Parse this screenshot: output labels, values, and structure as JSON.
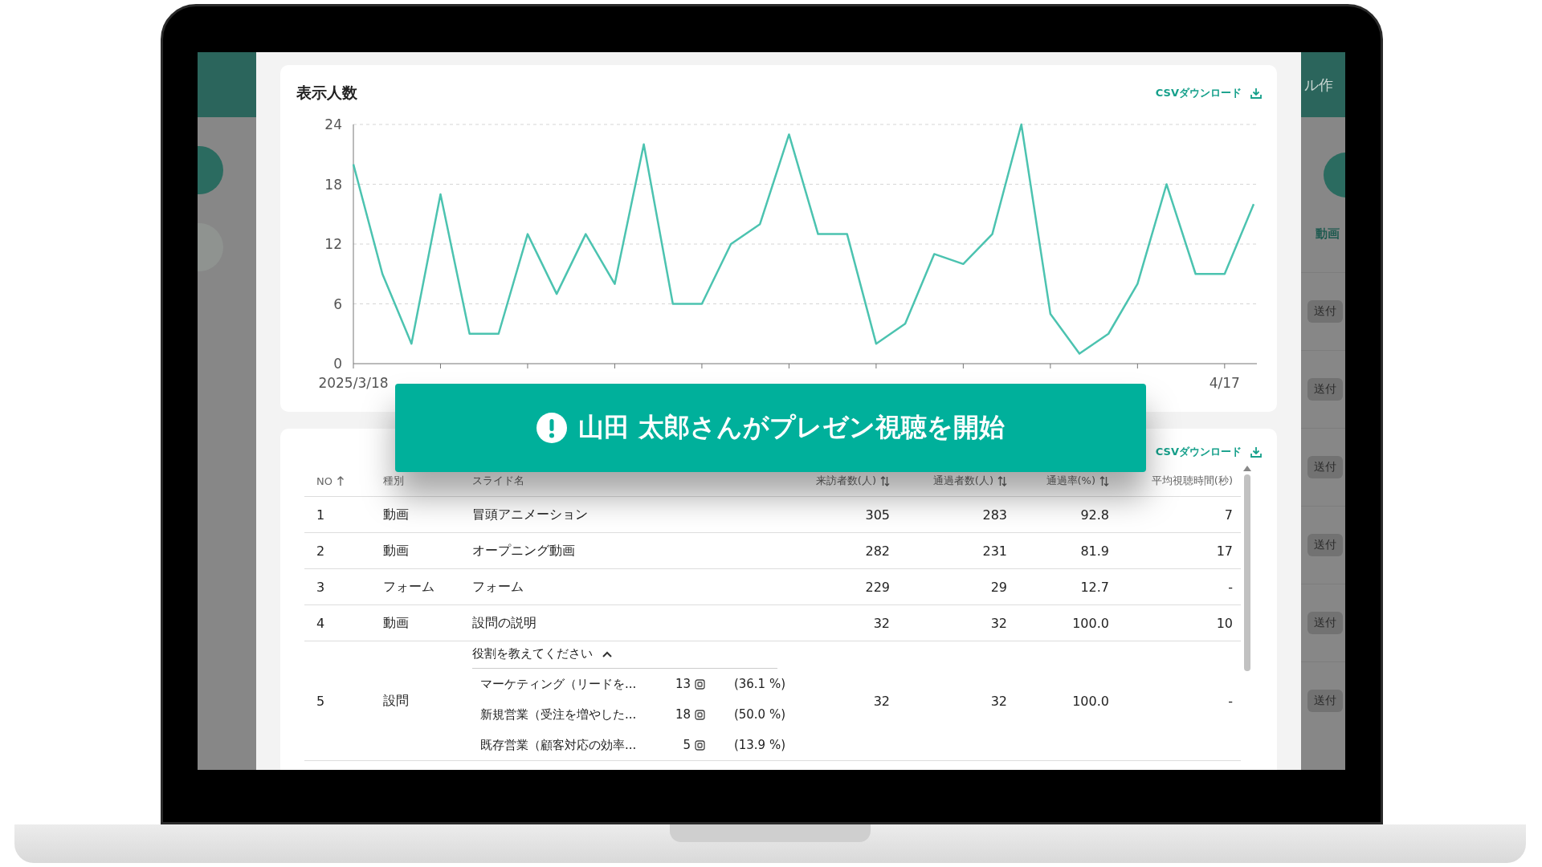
{
  "left_panel": {
    "avatars": [
      {
        "selected": true
      },
      {
        "selected": false
      }
    ]
  },
  "chart_card": {
    "title": "表示人数",
    "csv_link": "CSVダウンロード",
    "chart_data": {
      "type": "line",
      "grid": true,
      "ylim": [
        0,
        24
      ],
      "yticks": [
        0,
        6,
        12,
        18,
        24
      ],
      "categories": [
        "2025/3/18",
        null,
        null,
        null,
        null,
        null,
        null,
        null,
        null,
        null,
        null,
        null,
        null,
        null,
        null,
        null,
        null,
        null,
        null,
        null,
        null,
        null,
        null,
        null,
        null,
        null,
        null,
        null,
        null,
        null,
        "4/17",
        null
      ],
      "series": [
        {
          "color": "#4cc3b0",
          "values": [
            20,
            9,
            2,
            17,
            3,
            3,
            13,
            7,
            13,
            8,
            22,
            6,
            6,
            12,
            14,
            23,
            13,
            13,
            2,
            4,
            11,
            10,
            13,
            24,
            5,
            1,
            3,
            8,
            18,
            9,
            9,
            16
          ]
        }
      ]
    }
  },
  "table_card": {
    "csv_link": "CSVダウンロード",
    "columns": [
      {
        "label": "NO",
        "kind": "sorted"
      },
      {
        "label": "種別",
        "kind": "plain"
      },
      {
        "label": "スライド名",
        "kind": "plain"
      },
      {
        "label": "来訪者数(人)",
        "kind": "sortable"
      },
      {
        "label": "通過者数(人)",
        "kind": "sortable"
      },
      {
        "label": "通過率(%)",
        "kind": "sortable"
      },
      {
        "label": "平均視聴時間(秒)",
        "kind": "plain"
      }
    ],
    "rows": [
      {
        "no": "1",
        "type": "動画",
        "name": "冒頭アニメーション",
        "visitors": "305",
        "passed": "283",
        "rate": "92.8",
        "avg": "7"
      },
      {
        "no": "2",
        "type": "動画",
        "name": "オープニング動画",
        "visitors": "282",
        "passed": "231",
        "rate": "81.9",
        "avg": "17"
      },
      {
        "no": "3",
        "type": "フォーム",
        "name": "フォーム",
        "visitors": "229",
        "passed": "29",
        "rate": "12.7",
        "avg": "-"
      },
      {
        "no": "4",
        "type": "動画",
        "name": "設問の説明",
        "visitors": "32",
        "passed": "32",
        "rate": "100.0",
        "avg": "10"
      },
      {
        "no": "5",
        "type": "設問",
        "name": "役割を教えてください",
        "expanded": true,
        "visitors": "32",
        "passed": "32",
        "rate": "100.0",
        "avg": "-",
        "options": [
          {
            "label": "マーケティング（リードを...",
            "count": "13",
            "percent": "(36.1 %)"
          },
          {
            "label": "新規営業（受注を増やした...",
            "count": "18",
            "percent": "(50.0 %)"
          },
          {
            "label": "既存営業（顧客対応の効率...",
            "count": "5",
            "percent": "(13.9 %)"
          }
        ]
      }
    ]
  },
  "right_panel": {
    "header": "ル作",
    "section": "動画",
    "buttons": [
      "送付",
      "送付",
      "送付",
      "送付",
      "送付",
      "送付"
    ]
  },
  "toast": {
    "message": "山田 太郎さんがプレゼン視聴を開始"
  }
}
